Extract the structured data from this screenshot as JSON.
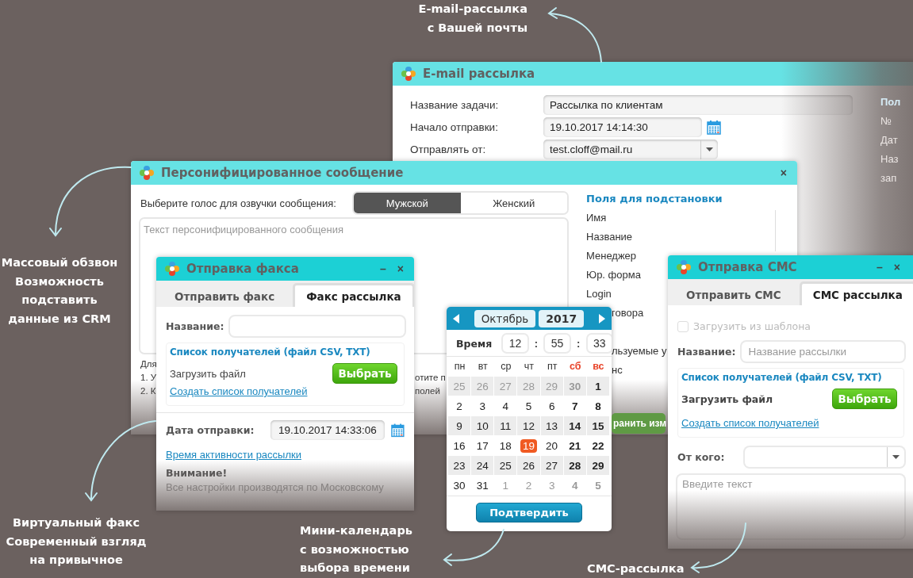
{
  "annotations": [
    {
      "kind": "email",
      "lines": [
        "E-mail-рассылка",
        "с Вашей почты"
      ]
    },
    {
      "kind": "call",
      "lines": [
        "Массовый обзвон",
        "Возможность",
        "подставить",
        "данные из CRM"
      ]
    },
    {
      "kind": "fax",
      "lines": [
        "Виртуальный факс",
        "Современный взгляд",
        "на привычное"
      ]
    },
    {
      "kind": "calendar",
      "lines": [
        "Мини-календарь",
        "с возможностью",
        "выбора времени"
      ]
    },
    {
      "kind": "sms",
      "lines": [
        "СМС-рассылка"
      ]
    }
  ],
  "email_window": {
    "title": "E-mail рассылка",
    "fields": [
      {
        "kind": "text",
        "label": "Название задачи:",
        "value": "Рассылка по клиентам"
      },
      {
        "kind": "date",
        "label": "Начало отправки:",
        "value": "19.10.2017 14:14:30"
      },
      {
        "kind": "select",
        "label": "Отправлять от:",
        "value": "test.cloff@mail.ru"
      }
    ],
    "side_fragments": [
      "Пол",
      "№",
      "Дат",
      "Наз",
      "зап"
    ]
  },
  "personal_window": {
    "title": "Персонифицированное сообщение",
    "controls": [
      "×"
    ],
    "voice_label": "Выберите голос для озвучки сообщения:",
    "voices": [
      {
        "label": "Мужской",
        "selected": true
      },
      {
        "label": "Женский",
        "selected": false
      }
    ],
    "message_placeholder": "Текст персонифицированного сообщения",
    "notes_left": [
      "Для",
      "1. У",
      "2. К"
    ],
    "notes_right": [
      "отите п",
      "полей"
    ],
    "fields_header": "Поля для подстановки",
    "fields": [
      {
        "label": "Имя",
        "kind": "full"
      },
      {
        "label": "Название",
        "kind": "full"
      },
      {
        "label": "Менеджер",
        "kind": "full"
      },
      {
        "label": "Юр. форма",
        "kind": "full"
      },
      {
        "label": "Login",
        "kind": "full"
      },
      {
        "label": "говора",
        "kind": "cut"
      },
      {
        "label": "льзуемые у",
        "kind": "cut_gap"
      },
      {
        "label": "нс",
        "kind": "cut"
      }
    ],
    "save_button": "ранить изм"
  },
  "fax_window": {
    "title": "Отправка факса",
    "controls": [
      "–",
      "×"
    ],
    "tabs": [
      {
        "label": "Отправить факс",
        "selected": false
      },
      {
        "label": "Факс рассылка",
        "selected": true
      }
    ],
    "name_label": "Название:",
    "recipients": {
      "header": "Список получателей (файл CSV, TXT)",
      "upload_label": "Загрузить файл",
      "choose_button": "Выбрать",
      "create_link": "Создать список получателей"
    },
    "date_label": "Дата отправки:",
    "date_value": "19.10.2017 14:33:06",
    "activity_link": "Время активности рассылки",
    "warning_title": "Внимание!",
    "warning_text": "Все настройки производятся по Московскому"
  },
  "calendar": {
    "month": "Октябрь",
    "year": "2017",
    "time_label": "Время",
    "time": [
      "12",
      "55",
      "33"
    ],
    "time_separator": ":",
    "weekdays": [
      {
        "label": "пн",
        "weekend": false
      },
      {
        "label": "вт",
        "weekend": false
      },
      {
        "label": "ср",
        "weekend": false
      },
      {
        "label": "чт",
        "weekend": false
      },
      {
        "label": "пт",
        "weekend": false
      },
      {
        "label": "сб",
        "weekend": true
      },
      {
        "label": "вс",
        "weekend": true
      }
    ],
    "weeks": [
      [
        {
          "label": "25",
          "muted": true,
          "selected": false
        },
        {
          "label": "26",
          "muted": true,
          "selected": false
        },
        {
          "label": "27",
          "muted": true,
          "selected": false
        },
        {
          "label": "28",
          "muted": true,
          "selected": false
        },
        {
          "label": "29",
          "muted": true,
          "selected": false
        },
        {
          "label": "30",
          "muted": true,
          "selected": false
        },
        {
          "label": "1",
          "muted": false,
          "selected": false
        }
      ],
      [
        {
          "label": "2",
          "muted": false,
          "selected": false
        },
        {
          "label": "3",
          "muted": false,
          "selected": false
        },
        {
          "label": "4",
          "muted": false,
          "selected": false
        },
        {
          "label": "5",
          "muted": false,
          "selected": false
        },
        {
          "label": "6",
          "muted": false,
          "selected": false
        },
        {
          "label": "7",
          "muted": false,
          "selected": false
        },
        {
          "label": "8",
          "muted": false,
          "selected": false
        }
      ],
      [
        {
          "label": "9",
          "muted": false,
          "selected": false
        },
        {
          "label": "10",
          "muted": false,
          "selected": false
        },
        {
          "label": "11",
          "muted": false,
          "selected": false
        },
        {
          "label": "12",
          "muted": false,
          "selected": false
        },
        {
          "label": "13",
          "muted": false,
          "selected": false
        },
        {
          "label": "14",
          "muted": false,
          "selected": false
        },
        {
          "label": "15",
          "muted": false,
          "selected": false
        }
      ],
      [
        {
          "label": "16",
          "muted": false,
          "selected": false
        },
        {
          "label": "17",
          "muted": false,
          "selected": false
        },
        {
          "label": "18",
          "muted": false,
          "selected": false
        },
        {
          "label": "19",
          "muted": false,
          "selected": true
        },
        {
          "label": "20",
          "muted": false,
          "selected": false
        },
        {
          "label": "21",
          "muted": false,
          "selected": false
        },
        {
          "label": "22",
          "muted": false,
          "selected": false
        }
      ],
      [
        {
          "label": "23",
          "muted": false,
          "selected": false
        },
        {
          "label": "24",
          "muted": false,
          "selected": false
        },
        {
          "label": "25",
          "muted": false,
          "selected": false
        },
        {
          "label": "26",
          "muted": false,
          "selected": false
        },
        {
          "label": "27",
          "muted": false,
          "selected": false
        },
        {
          "label": "28",
          "muted": false,
          "selected": false
        },
        {
          "label": "29",
          "muted": false,
          "selected": false
        }
      ],
      [
        {
          "label": "30",
          "muted": false,
          "selected": false
        },
        {
          "label": "31",
          "muted": false,
          "selected": false
        },
        {
          "label": "1",
          "muted": true,
          "selected": false
        },
        {
          "label": "2",
          "muted": true,
          "selected": false
        },
        {
          "label": "3",
          "muted": true,
          "selected": false
        },
        {
          "label": "4",
          "muted": true,
          "selected": false
        },
        {
          "label": "5",
          "muted": true,
          "selected": false
        }
      ]
    ],
    "confirm_button": "Подтвердить"
  },
  "sms_window": {
    "title": "Отправка СМС",
    "controls": [
      "–",
      "×"
    ],
    "tabs": [
      {
        "label": "Отправить СМС",
        "selected": false
      },
      {
        "label": "СМС рассылка",
        "selected": true
      }
    ],
    "template": {
      "label": "Загрузить из шаблона",
      "checked": false,
      "disabled": true
    },
    "name_label": "Название:",
    "name_placeholder": "Название рассылки",
    "recipients": {
      "header": "Список получателей (файл CSV, TXT)",
      "upload_label": "Загрузить файл",
      "choose_button": "Выбрать",
      "create_link": "Создать список получателей"
    },
    "from_label": "От кого:",
    "text_placeholder": "Введите текст"
  }
}
